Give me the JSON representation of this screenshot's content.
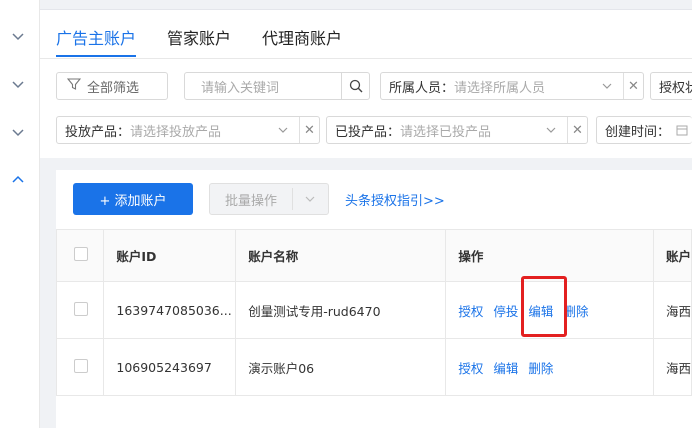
{
  "tabs": [
    {
      "label": "广告主账户"
    },
    {
      "label": "管家账户"
    },
    {
      "label": "代理商账户"
    }
  ],
  "filters": {
    "all_label": "全部筛选",
    "search_placeholder": "请输入关键词",
    "owner": {
      "label": "所属人员：",
      "placeholder": "请选择所属人员"
    },
    "auth_status": {
      "label": "授权状"
    },
    "product": {
      "label": "投放产品：",
      "placeholder": "请选择投放产品"
    },
    "launched_product": {
      "label": "已投产品：",
      "placeholder": "请选择已投产品"
    },
    "created_time": {
      "label": "创建时间："
    }
  },
  "toolbar": {
    "add_account": "+ 添加账户",
    "batch_ops": "批量操作",
    "auth_guide": "头条授权指引>>"
  },
  "table": {
    "headers": [
      "账户ID",
      "账户名称",
      "操作",
      "账户"
    ],
    "rows": [
      {
        "id": "1639747085036...",
        "name": "创量测试专用-rud6470",
        "ops": [
          "授权",
          "停投",
          "编辑",
          "删除"
        ],
        "extra": "海西"
      },
      {
        "id": "106905243697",
        "name": "演示账户06",
        "ops": [
          "授权",
          "编辑",
          "删除"
        ],
        "extra": "海西"
      }
    ]
  },
  "colors": {
    "accent": "#1a73e8",
    "highlight": "#e32020"
  }
}
